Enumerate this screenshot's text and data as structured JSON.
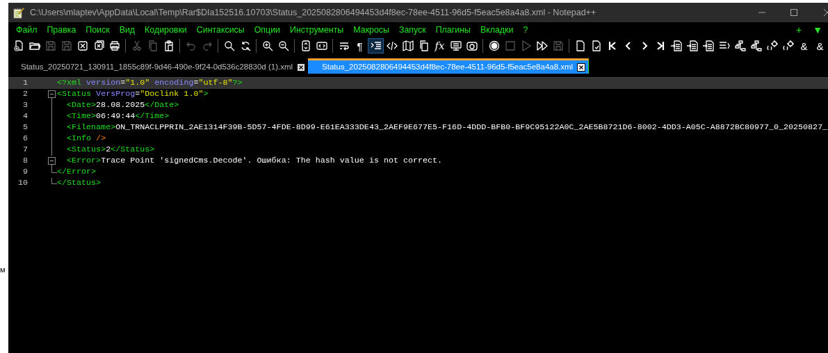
{
  "background": {
    "fragment": "м"
  },
  "window": {
    "title": "C:\\Users\\mlaptev\\AppData\\Local\\Temp\\Rar$DIa152516.10703\\Status_2025082806494453d4f8ec-78ee-4511-96d5-f5eac5e8a4a8.xml - Notepad++"
  },
  "menu": [
    "Файл",
    "Правка",
    "Поиск",
    "Вид",
    "Кодировки",
    "Синтаксисы",
    "Опции",
    "Инструменты",
    "Макросы",
    "Запуск",
    "Плагины",
    "Вкладки",
    "?"
  ],
  "menu_right": [
    "+",
    "▼"
  ],
  "toolbar": [
    {
      "kind": "new",
      "disabled": false,
      "selected": false
    },
    {
      "kind": "open",
      "disabled": false,
      "selected": false
    },
    {
      "kind": "save",
      "disabled": true,
      "selected": false
    },
    {
      "kind": "saveall",
      "disabled": true,
      "selected": false
    },
    {
      "kind": "close",
      "disabled": false,
      "selected": false
    },
    {
      "kind": "closeall",
      "disabled": false,
      "selected": false
    },
    {
      "kind": "print",
      "disabled": false,
      "selected": false
    },
    {
      "kind": "sep"
    },
    {
      "kind": "cut",
      "disabled": true,
      "selected": false
    },
    {
      "kind": "copy",
      "disabled": true,
      "selected": false
    },
    {
      "kind": "paste",
      "disabled": false,
      "selected": false
    },
    {
      "kind": "sep"
    },
    {
      "kind": "undo",
      "disabled": true,
      "selected": false
    },
    {
      "kind": "redo",
      "disabled": true,
      "selected": false
    },
    {
      "kind": "sep"
    },
    {
      "kind": "find",
      "disabled": false,
      "selected": false
    },
    {
      "kind": "replace",
      "disabled": false,
      "selected": false
    },
    {
      "kind": "sep"
    },
    {
      "kind": "zoomin",
      "disabled": false,
      "selected": false
    },
    {
      "kind": "zoomout",
      "disabled": false,
      "selected": false
    },
    {
      "kind": "sep"
    },
    {
      "kind": "syncv",
      "disabled": false,
      "selected": false
    },
    {
      "kind": "synch",
      "disabled": false,
      "selected": false
    },
    {
      "kind": "sep"
    },
    {
      "kind": "wrap",
      "disabled": false,
      "selected": false
    },
    {
      "kind": "glyph",
      "glyph": "¶",
      "disabled": false,
      "selected": false
    },
    {
      "kind": "indent",
      "disabled": false,
      "selected": true
    },
    {
      "kind": "tag",
      "disabled": false,
      "selected": false
    },
    {
      "kind": "map",
      "disabled": false,
      "selected": false
    },
    {
      "kind": "copy",
      "disabled": false,
      "selected": false
    },
    {
      "kind": "glyph",
      "glyph": "fx",
      "disabled": false,
      "selected": false
    },
    {
      "kind": "monitor",
      "disabled": false,
      "selected": false
    },
    {
      "kind": "camera",
      "disabled": false,
      "selected": false
    },
    {
      "kind": "sep"
    },
    {
      "kind": "record",
      "disabled": false,
      "selected": false
    },
    {
      "kind": "stop",
      "disabled": true,
      "selected": false
    },
    {
      "kind": "play",
      "disabled": true,
      "selected": false
    },
    {
      "kind": "playmany",
      "disabled": false,
      "selected": false
    },
    {
      "kind": "save",
      "disabled": true,
      "selected": false
    },
    {
      "kind": "sep"
    },
    {
      "kind": "doc",
      "disabled": false,
      "selected": false
    },
    {
      "kind": "doccheck",
      "disabled": false,
      "selected": false
    },
    {
      "kind": "first",
      "disabled": false,
      "selected": false
    },
    {
      "kind": "prev",
      "disabled": false,
      "selected": false
    },
    {
      "kind": "next",
      "disabled": false,
      "selected": false
    },
    {
      "kind": "last",
      "disabled": false,
      "selected": false
    },
    {
      "kind": "import",
      "disabled": false,
      "selected": false
    },
    {
      "kind": "import",
      "disabled": false,
      "selected": false
    },
    {
      "kind": "import",
      "disabled": false,
      "selected": false
    },
    {
      "kind": "lines",
      "disabled": false,
      "selected": false
    },
    {
      "kind": "tree",
      "disabled": false,
      "selected": false
    },
    {
      "kind": "tree",
      "disabled": false,
      "selected": false
    },
    {
      "kind": "gear",
      "disabled": false,
      "selected": false
    },
    {
      "kind": "gear",
      "disabled": false,
      "selected": false
    },
    {
      "kind": "glyph",
      "glyph": "&",
      "disabled": false,
      "selected": false
    },
    {
      "kind": "glyph",
      "glyph": "&",
      "disabled": false,
      "selected": false
    }
  ],
  "tabs": [
    {
      "label": "Status_20250721_130911_1855c89f-9d46-490e-9f24-0d536c28830d (1).xml",
      "selected": false
    },
    {
      "label": "Status_2025082806494453d4f8ec-78ee-4511-96d5-f5eac5e8a4a8.xml",
      "selected": true
    }
  ],
  "editor": {
    "lines": [
      {
        "number": "1",
        "current": true,
        "kind": "plain",
        "tokens": [
          {
            "kind": "tag",
            "text": "<?xml"
          },
          {
            "kind": "attr",
            "text": " version"
          },
          {
            "kind": "op",
            "text": "="
          },
          {
            "kind": "val",
            "text": "\"1.0\""
          },
          {
            "kind": "attr",
            "text": " encoding"
          },
          {
            "kind": "op",
            "text": "="
          },
          {
            "kind": "val",
            "text": "\"utf-8\""
          },
          {
            "kind": "tag",
            "text": "?>"
          }
        ]
      },
      {
        "number": "2",
        "current": false,
        "kind": "start",
        "tokens": [
          {
            "kind": "tag",
            "text": "<Status"
          },
          {
            "kind": "attr",
            "text": " VersProg"
          },
          {
            "kind": "op",
            "text": "="
          },
          {
            "kind": "val",
            "text": "\"Doclink 1.0\""
          },
          {
            "kind": "tag",
            "text": ">"
          }
        ]
      },
      {
        "number": "3",
        "current": false,
        "kind": "body",
        "tokens": [
          {
            "kind": "tag",
            "text": "  <Date>"
          },
          {
            "kind": "text",
            "text": "28.08.2025"
          },
          {
            "kind": "tag",
            "text": "</Date>"
          }
        ]
      },
      {
        "number": "4",
        "current": false,
        "kind": "body",
        "tokens": [
          {
            "kind": "tag",
            "text": "  <Time>"
          },
          {
            "kind": "text",
            "text": "06:49:44"
          },
          {
            "kind": "tag",
            "text": "</Time>"
          }
        ]
      },
      {
        "number": "5",
        "current": false,
        "kind": "body",
        "tokens": [
          {
            "kind": "tag",
            "text": "  <Filename>"
          },
          {
            "kind": "text",
            "text": "ON_TRNACLPPRIN_2AE1314F39B-5D57-4FDE-8D99-E61EA333DE43_2AEF9E677E5-F16D-4DDD-BFB0-BF9C95122A0C_2AE5B8721D6-8002-4DD3-A05C-A8872BC80977_0_20250827_"
          }
        ]
      },
      {
        "number": "6",
        "current": false,
        "kind": "body",
        "tokens": [
          {
            "kind": "tag",
            "text": "  <Info"
          },
          {
            "kind": "empty",
            "text": " />"
          }
        ]
      },
      {
        "number": "7",
        "current": false,
        "kind": "body",
        "tokens": [
          {
            "kind": "tag",
            "text": "  <Status>"
          },
          {
            "kind": "text",
            "text": "2"
          },
          {
            "kind": "tag",
            "text": "</Status>"
          }
        ]
      },
      {
        "number": "8",
        "current": false,
        "kind": "start",
        "tokens": [
          {
            "kind": "tag",
            "text": "  <Error>"
          },
          {
            "kind": "text",
            "text": "Trace Point 'signedCms.Decode'. Ошибка: The hash value is not correct."
          }
        ]
      },
      {
        "number": "9",
        "current": false,
        "kind": "end",
        "tokens": [
          {
            "kind": "tag",
            "text": "</Error>"
          }
        ]
      },
      {
        "number": "10",
        "current": false,
        "kind": "end",
        "tokens": [
          {
            "kind": "tag",
            "text": "</Status>"
          }
        ]
      }
    ]
  }
}
